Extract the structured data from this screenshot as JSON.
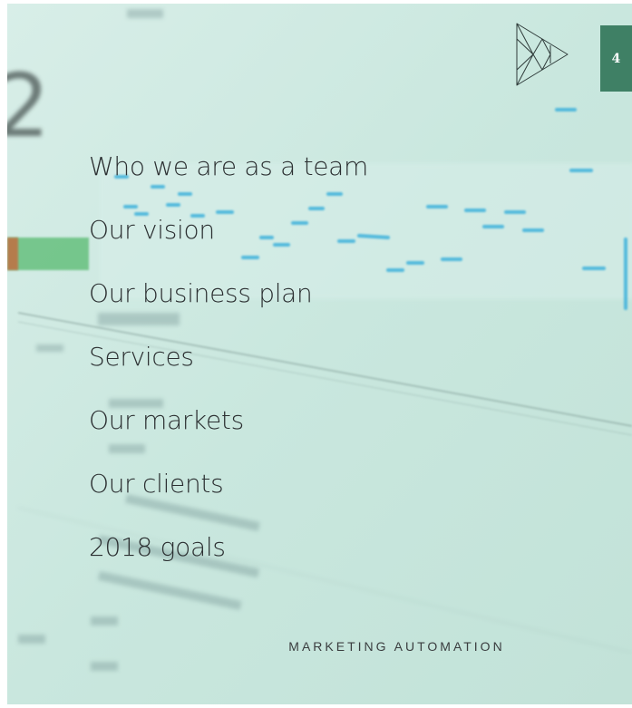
{
  "page_number": "4",
  "menu": [
    {
      "label": "Who we are as a team"
    },
    {
      "label": "Our vision"
    },
    {
      "label": "Our business plan"
    },
    {
      "label": "Services"
    },
    {
      "label": "Our markets"
    },
    {
      "label": "Our clients"
    },
    {
      "label": "2018 goals"
    }
  ],
  "footer": "MARKETING AUTOMATION",
  "colors": {
    "background_tint": "#cfe8e0",
    "badge": "#3f8065",
    "text": "#2b2f31",
    "chart_dashes": "#44b4dc"
  },
  "icons": {
    "logo": "triangle-logo-icon"
  }
}
